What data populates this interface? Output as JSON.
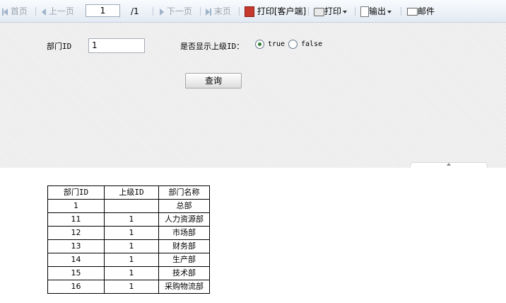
{
  "toolbar": {
    "first": "首页",
    "prev": "上一页",
    "page_value": "1",
    "page_total": "/1",
    "next": "下一页",
    "last": "末页",
    "print_client": "打印[客户端]",
    "print": "打印",
    "export": "输出",
    "mail": "邮件"
  },
  "params": {
    "dept_id_label": "部门ID",
    "dept_id_value": "1",
    "show_parent_label": "是否显示上级ID：",
    "radio_true": "true",
    "radio_false": "false",
    "selected": "true",
    "query_button": "查询"
  },
  "report": {
    "headers": [
      "部门ID",
      "上级ID",
      "部门名称"
    ],
    "rows": [
      [
        "1",
        "",
        "总部"
      ],
      [
        "11",
        "1",
        "人力资源部"
      ],
      [
        "12",
        "1",
        "市场部"
      ],
      [
        "13",
        "1",
        "财务部"
      ],
      [
        "14",
        "1",
        "生产部"
      ],
      [
        "15",
        "1",
        "技术部"
      ],
      [
        "16",
        "1",
        "采购物流部"
      ]
    ]
  },
  "icons": [
    "first-page-icon",
    "prev-page-icon",
    "next-page-icon",
    "last-page-icon",
    "pdf-icon",
    "printer-icon",
    "export-icon",
    "mail-icon"
  ]
}
